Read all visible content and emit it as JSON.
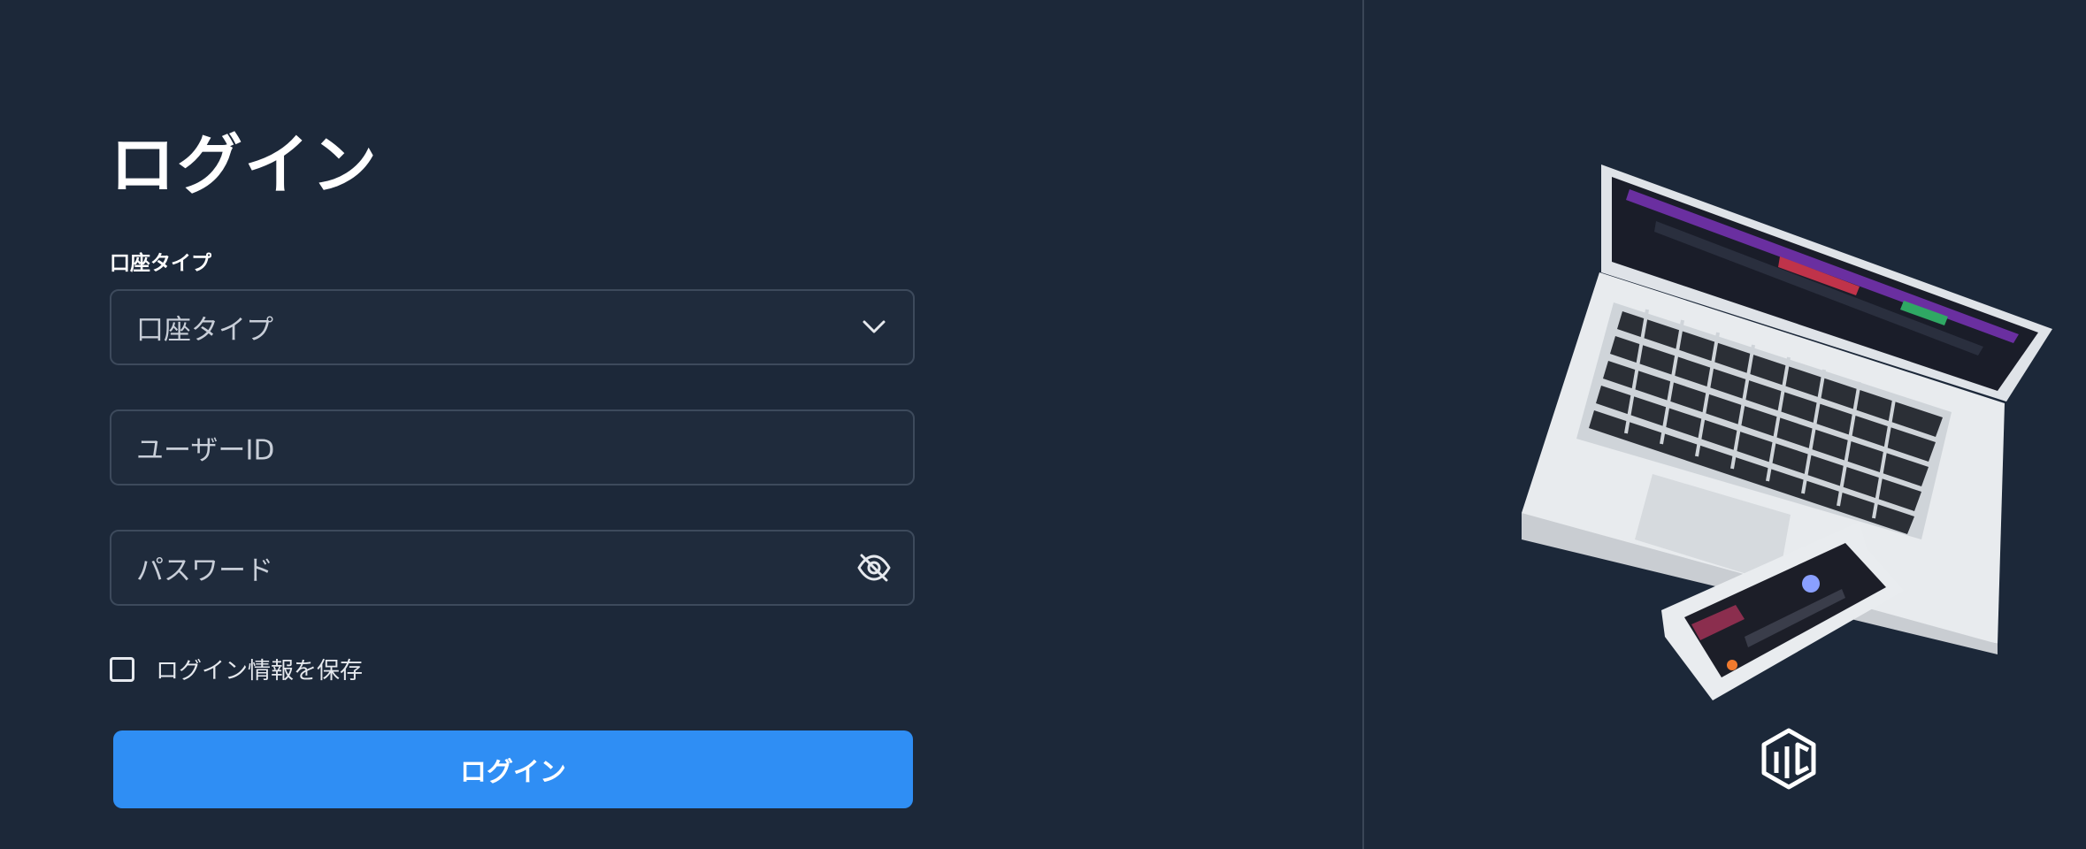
{
  "login": {
    "title": "ログイン",
    "account_type_label": "口座タイプ",
    "account_type_value": "口座タイプ",
    "user_id_placeholder": "ユーザーID",
    "password_placeholder": "パスワード",
    "remember_label": "ログイン情報を保存",
    "submit_label": "ログイン"
  },
  "icons": {
    "select_chevron": "chevron-down-icon",
    "password_toggle": "eye-off-icon",
    "brand": "brand-logo-icon"
  },
  "colors": {
    "background": "#1c2839",
    "accent": "#2f8ef4",
    "field_border": "#3d4a5c",
    "text_muted": "#c8ced8"
  }
}
